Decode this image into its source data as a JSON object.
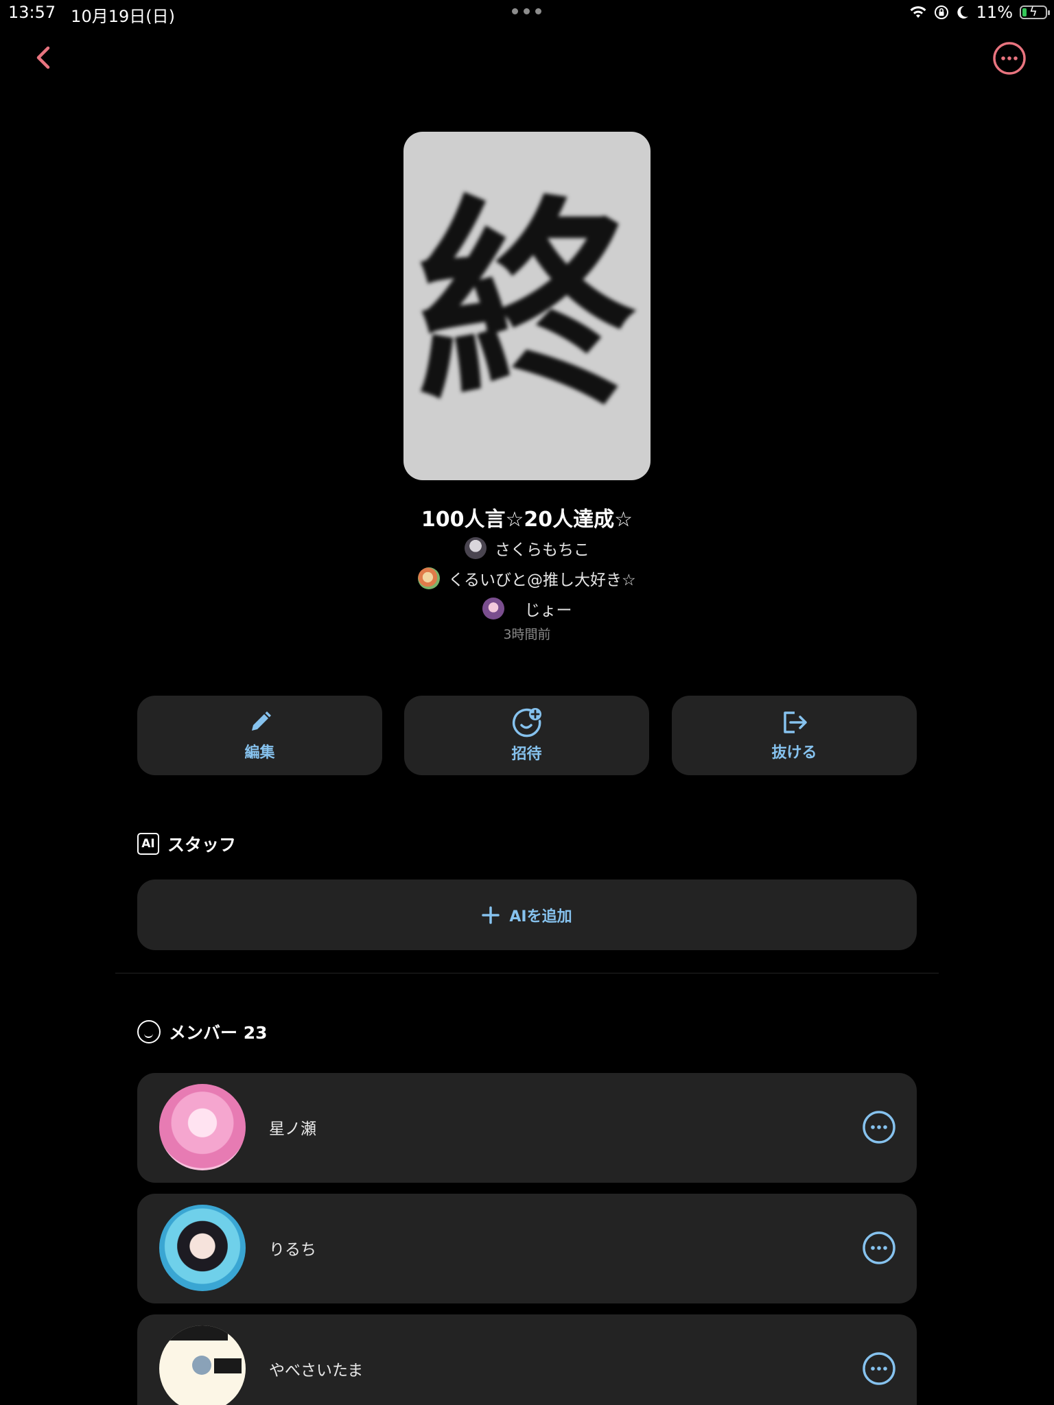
{
  "status_bar": {
    "time": "13:57",
    "date": "10月19日(日)",
    "battery": "11%",
    "icons": [
      "wifi-icon",
      "rotation-lock-icon",
      "moon-icon",
      "battery-icon"
    ]
  },
  "nav": {
    "back_icon": "chevron-left-icon",
    "more_icon": "more-circle-icon",
    "accent": "#e8747f"
  },
  "cover": {
    "glyph": "終"
  },
  "room": {
    "title": "100人言☆20人達成☆",
    "authors": [
      {
        "name": "さくらもちこ"
      },
      {
        "name": "くるいびと@推し大好き☆"
      },
      {
        "name": "じょー"
      }
    ],
    "updated": "3時間前"
  },
  "actions": {
    "edit_label": "編集",
    "invite_label": "招待",
    "leave_label": "抜ける",
    "accent": "#86c2ee"
  },
  "staff": {
    "badge": "AI",
    "heading": "スタッフ",
    "add_label": "AIを追加"
  },
  "members": {
    "heading": "メンバー 23",
    "items": [
      {
        "name": "星ノ瀬"
      },
      {
        "name": "りるち"
      },
      {
        "name": "やべさいたま"
      }
    ]
  }
}
